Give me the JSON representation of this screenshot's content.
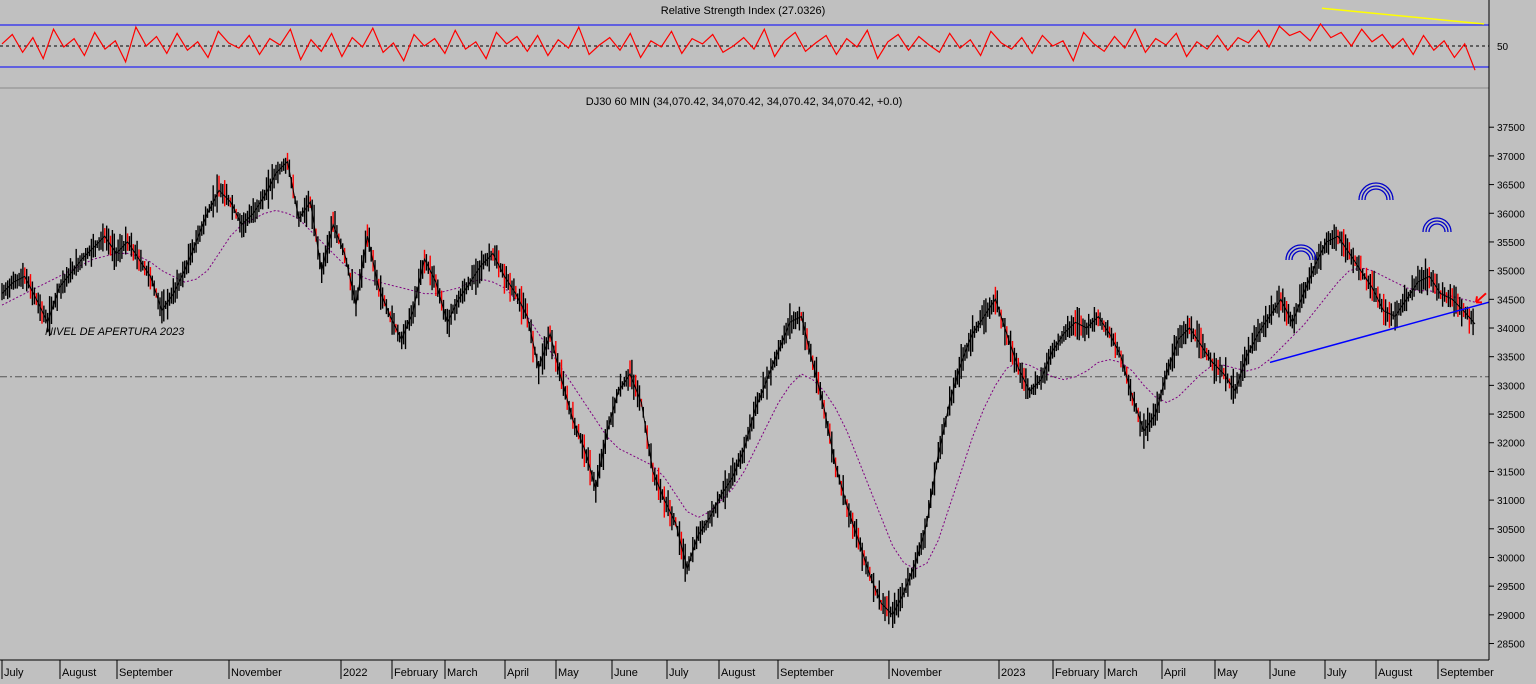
{
  "colors": {
    "background": "#c0c0c0",
    "rsi_line": "#ff0000",
    "rsi_bands": "#0000ff",
    "rsi_trend": "#ffff00",
    "price_bar": "#000000",
    "price_down_segment": "#ff0000",
    "moving_average": "#800080",
    "support_line": "#0000ff",
    "pattern_arcs": "#0000c8",
    "arrow": "#ff0000",
    "opening_level": "#555555"
  },
  "rsi_panel": {
    "title": "Relative Strength Index (27.0326)",
    "axis_label": "50",
    "levels": [
      70,
      50,
      30
    ]
  },
  "price_panel": {
    "title": "DJ30 60 MIN (34,070.42, 34,070.42, 34,070.42, 34,070.42, +0.0)",
    "annotation": "NIVEL DE APERTURA 2023",
    "opening_level": 33150
  },
  "chart_data": [
    {
      "type": "line",
      "title": "Relative Strength Index (27.0326)",
      "series": [
        {
          "name": "Relative Strength Index",
          "values": [
            52,
            61,
            44,
            58,
            38,
            66,
            49,
            57,
            41,
            63,
            47,
            55,
            35,
            68,
            50,
            59,
            43,
            62,
            46,
            54,
            39,
            64,
            53,
            48,
            60,
            42,
            57,
            51,
            66,
            37,
            56,
            45,
            62,
            40,
            58,
            49,
            67,
            44,
            53,
            36,
            61,
            50,
            57,
            43,
            65,
            47,
            54,
            38,
            63,
            52,
            59,
            45,
            60,
            41,
            56,
            48,
            68,
            42,
            51,
            58,
            46,
            62,
            39,
            55,
            49,
            64,
            43,
            57,
            52,
            61,
            44,
            50,
            58,
            47,
            66,
            40,
            55,
            63,
            45,
            53,
            60,
            42,
            57,
            49,
            65,
            38,
            54,
            61,
            46,
            59,
            51,
            44,
            62,
            48,
            56,
            41,
            64,
            53,
            47,
            58,
            43,
            60,
            50,
            55,
            36,
            63,
            52,
            45,
            59,
            48,
            66,
            44,
            57,
            51,
            62,
            40,
            54,
            47,
            60,
            46,
            58,
            53,
            65,
            49,
            69,
            60,
            64,
            55,
            71,
            58,
            63,
            50,
            66,
            54,
            61,
            48,
            57,
            42,
            60,
            46,
            55,
            39,
            52,
            27
          ]
        }
      ],
      "ylim": [
        20,
        80
      ],
      "reference_lines": [
        70,
        50,
        30
      ],
      "trendline": {
        "x": [
          "July 2023",
          "September 2023"
        ],
        "y": [
          86,
          71
        ]
      }
    },
    {
      "type": "line",
      "title": "DJ30 60 MIN (34,070.42, 34,070.42, 34,070.42, 34,070.42, +0.0)",
      "x_ticks": [
        "July",
        "August",
        "September",
        "November",
        "2022",
        "February",
        "March",
        "April",
        "May",
        "June",
        "July",
        "August",
        "September",
        "November",
        "2023",
        "February",
        "March",
        "April",
        "May",
        "June",
        "July",
        "August",
        "September"
      ],
      "y_ticks": [
        28500,
        29000,
        29500,
        30000,
        30500,
        31000,
        31500,
        32000,
        32500,
        33000,
        33500,
        34000,
        34500,
        35000,
        35500,
        36000,
        36500,
        37000,
        37500
      ],
      "ylim": [
        28300,
        37800
      ],
      "series": [
        {
          "name": "DJ30",
          "values": [
            34600,
            34800,
            34900,
            34500,
            34100,
            34700,
            34950,
            35200,
            35400,
            35600,
            35300,
            35500,
            35200,
            34900,
            34300,
            34600,
            35000,
            35500,
            36000,
            36400,
            36200,
            35800,
            36000,
            36300,
            36700,
            36900,
            35900,
            36200,
            35000,
            35800,
            35300,
            34400,
            35600,
            34700,
            34200,
            33800,
            34300,
            35200,
            34800,
            34100,
            34500,
            34800,
            35100,
            35300,
            34900,
            34600,
            34200,
            33300,
            33900,
            33100,
            32400,
            31900,
            31200,
            32200,
            32900,
            33200,
            32700,
            31500,
            31000,
            30600,
            29800,
            30400,
            30700,
            31100,
            31400,
            31900,
            32600,
            33100,
            33600,
            34100,
            34200,
            33400,
            32600,
            31600,
            30900,
            30300,
            29700,
            29200,
            29000,
            29400,
            29900,
            30600,
            31800,
            32700,
            33400,
            33900,
            34200,
            34500,
            33900,
            33300,
            32900,
            33100,
            33600,
            33900,
            34100,
            34000,
            34200,
            33900,
            33500,
            32800,
            32200,
            32500,
            33200,
            33800,
            34000,
            33700,
            33400,
            33200,
            32900,
            33500,
            33900,
            34200,
            34500,
            34100,
            34600,
            35100,
            35500,
            35600,
            35300,
            35000,
            34700,
            34300,
            34200,
            34500,
            34800,
            34900,
            34600,
            34500,
            34300,
            34070
          ]
        },
        {
          "name": "Moving average",
          "values": [
            34400,
            34500,
            34600,
            34700,
            34800,
            34900,
            35000,
            35100,
            35200,
            35250,
            35300,
            35300,
            35250,
            35150,
            35000,
            34900,
            34800,
            34850,
            35000,
            35300,
            35600,
            35800,
            35900,
            36000,
            36050,
            36000,
            35900,
            35700,
            35500,
            35300,
            35100,
            34950,
            34850,
            34800,
            34750,
            34700,
            34650,
            34600,
            34600,
            34650,
            34700,
            34800,
            34850,
            34800,
            34700,
            34500,
            34200,
            33900,
            33600,
            33300,
            33000,
            32700,
            32400,
            32100,
            31900,
            31800,
            31700,
            31600,
            31400,
            31100,
            30800,
            30700,
            30800,
            31000,
            31200,
            31500,
            31900,
            32300,
            32700,
            33000,
            33200,
            33100,
            32900,
            32600,
            32200,
            31700,
            31200,
            30700,
            30200,
            29900,
            29800,
            29900,
            30300,
            30900,
            31500,
            32100,
            32600,
            33000,
            33300,
            33400,
            33350,
            33250,
            33150,
            33100,
            33150,
            33250,
            33400,
            33450,
            33400,
            33250,
            33000,
            32800,
            32700,
            32800,
            33000,
            33200,
            33350,
            33350,
            33300,
            33250,
            33300,
            33450,
            33650,
            33850,
            34050,
            34300,
            34550,
            34800,
            35000,
            35050,
            35000,
            34900,
            34800,
            34700,
            34650,
            34650,
            34600,
            34550,
            34500,
            34450
          ]
        }
      ],
      "support_line": {
        "from": 33400,
        "to": 34450
      },
      "annotation": "NIVEL DE APERTURA 2023",
      "opening_level": 33150,
      "last_close": 34070.42
    }
  ]
}
